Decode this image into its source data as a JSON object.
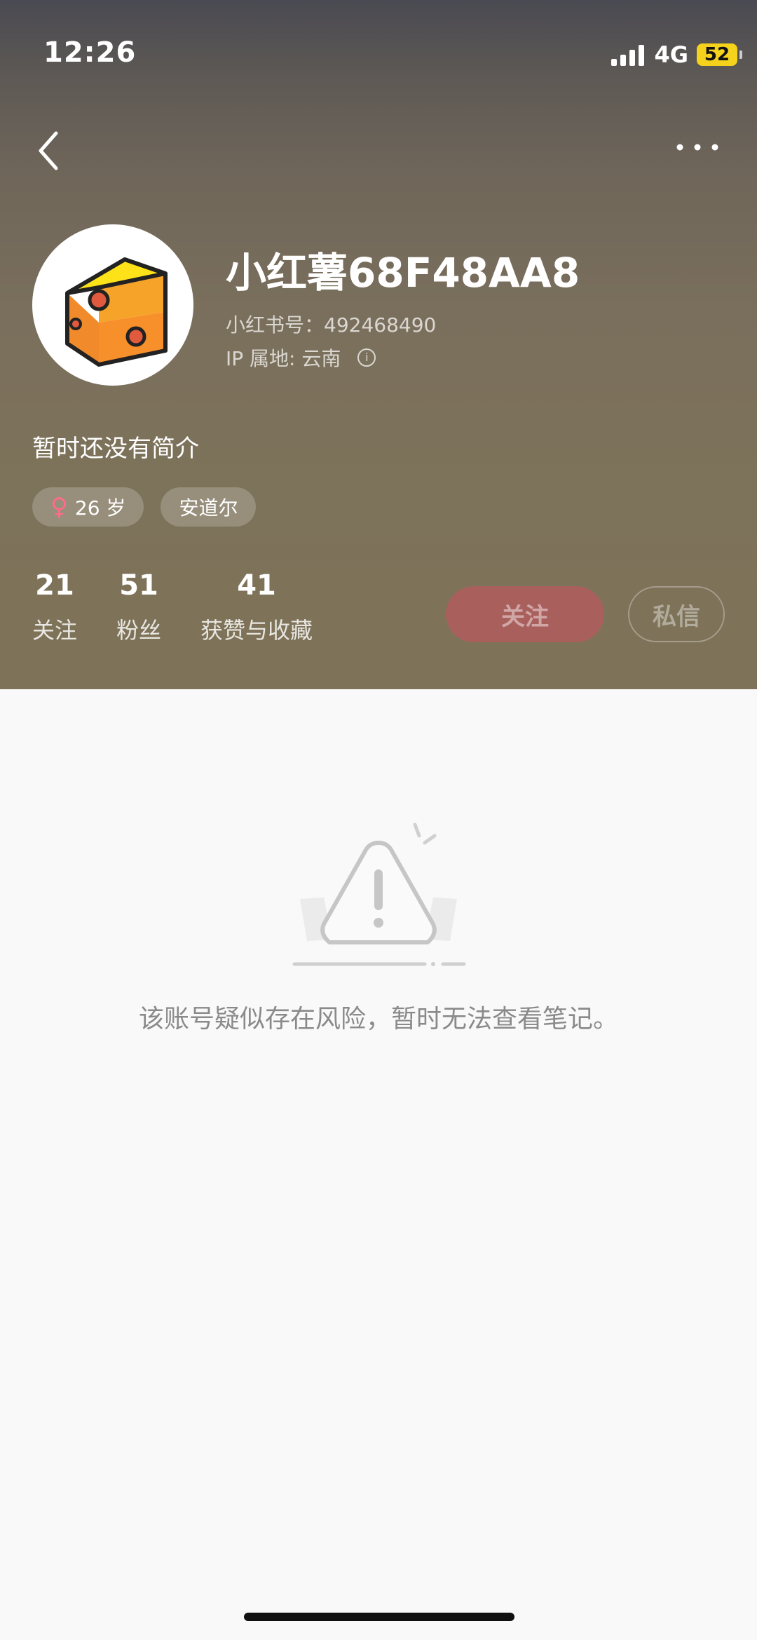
{
  "status_bar": {
    "time": "12:26",
    "network": "4G",
    "battery": "52"
  },
  "profile": {
    "nickname": "小红薯68F48AA8",
    "id_label": "小红书号：",
    "id_value": "492468490",
    "ip_label": "IP 属地: 云南",
    "bio": "暂时还没有简介",
    "tags": {
      "gender_symbol": "♀",
      "age": "26 岁",
      "location": "安道尔"
    },
    "stats": [
      {
        "num": "21",
        "label": "关注"
      },
      {
        "num": "51",
        "label": "粉丝"
      },
      {
        "num": "41",
        "label": "获赞与收藏"
      }
    ],
    "follow_label": "关注",
    "message_label": "私信"
  },
  "notice": {
    "text": "该账号疑似存在风险，暂时无法查看笔记。"
  },
  "colors": {
    "accent": "#ff2442",
    "battery": "#f5d21b",
    "gender": "#ff6b8a"
  }
}
